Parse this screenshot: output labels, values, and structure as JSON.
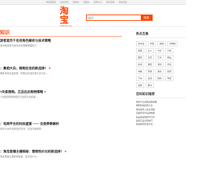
{
  "top_nav": [
    "淘宝网首页",
    "我的淘宝",
    "购物车",
    "收藏夹",
    "卖家中心",
    "联系客服",
    "网站导航"
  ],
  "logo": {
    "main": "淘宝",
    "sub": "Taobao.com"
  },
  "search": {
    "value": "宝贝",
    "button": "搜索"
  },
  "section": {
    "title": "知识"
  },
  "articles": [
    {
      "title": "游者首页千名的角色解析与技术策略",
      "summary": "游戏策划首页素材优化需要根据用户..."
    },
    {
      "title": "：真相大白，购物后良的新选择！",
      "summary": "随着电商迅猛发展，购物后的选择更为多元化..."
    },
    {
      "title": "7天极限购，正品在此购物策略",
      "summary": "7天极限购物新模式已经成为消费者..."
    },
    {
      "title": "：电商平台的科技盛宴 —— 全面参数解析",
      "summary": "电商平台科技新品的评测，包含详细参数..."
    },
    {
      "title": "：淘宝直播主播探秘：营销性价比的新选择！",
      "summary": "淘宝直播主播营销探秘，真实性价比..."
    }
  ],
  "sidebar": {
    "hot_title": "热点互推",
    "tags": [
      "纪中会",
      "中国",
      "模物",
      "内物物",
      "美国",
      "主义",
      "中文",
      "分类",
      "图形",
      "天安",
      "艺术",
      "网站",
      "新闻",
      "服装",
      "游戏",
      "手机",
      "电脑",
      "家居",
      "美食",
      "旅游",
      "汽车",
      "运动",
      "数码",
      "母婴",
      "品牌",
      "图书"
    ],
    "rec_title": "百科知识推荐",
    "rec_items": [
      "电商平台选购完美攻略",
      "网购防骗指南大全",
      "淘宝卖家入驻全流程",
      "直播带货背后的数据",
      "新品首发购物节日历",
      "品牌正品识别技巧",
      "快递物流查询方法"
    ]
  }
}
